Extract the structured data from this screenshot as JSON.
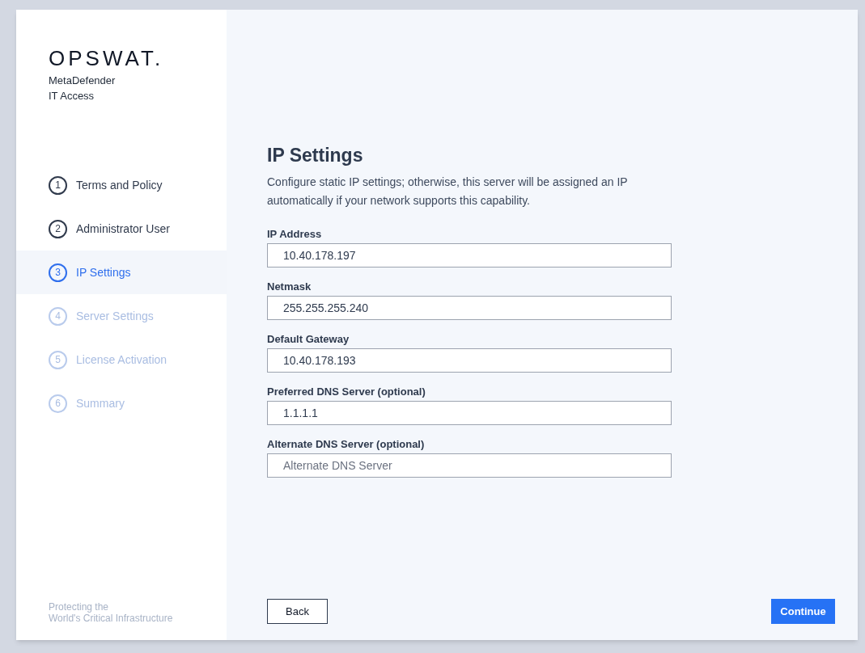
{
  "brand": {
    "logo": "OPSWAT.",
    "product_line_1": "MetaDefender",
    "product_line_2": "IT Access"
  },
  "steps": [
    {
      "number": "1",
      "label": "Terms and Policy",
      "selected": false,
      "disabled": false
    },
    {
      "number": "2",
      "label": "Administrator User",
      "selected": false,
      "disabled": false
    },
    {
      "number": "3",
      "label": "IP Settings",
      "selected": true,
      "disabled": false
    },
    {
      "number": "4",
      "label": "Server Settings",
      "selected": false,
      "disabled": true
    },
    {
      "number": "5",
      "label": "License Activation",
      "selected": false,
      "disabled": true
    },
    {
      "number": "6",
      "label": "Summary",
      "selected": false,
      "disabled": true
    }
  ],
  "tagline": [
    "Protecting the",
    "World's Critical Infrastructure"
  ],
  "page": {
    "title": "IP Settings",
    "description": "Configure static IP settings; otherwise, this server will be assigned an IP automatically if your network supports this capability."
  },
  "fields": [
    {
      "label": "IP Address",
      "value": "10.40.178.197"
    },
    {
      "label": "Netmask",
      "value": "255.255.255.240"
    },
    {
      "label": "Default Gateway",
      "value": "10.40.178.193"
    },
    {
      "label": "Preferred DNS Server (optional)",
      "value": "1.1.1.1"
    },
    {
      "label": "Alternate DNS Server (optional)",
      "placeholder": "Alternate DNS Server"
    }
  ],
  "buttons": {
    "back": "Back",
    "continue": "Continue"
  }
}
